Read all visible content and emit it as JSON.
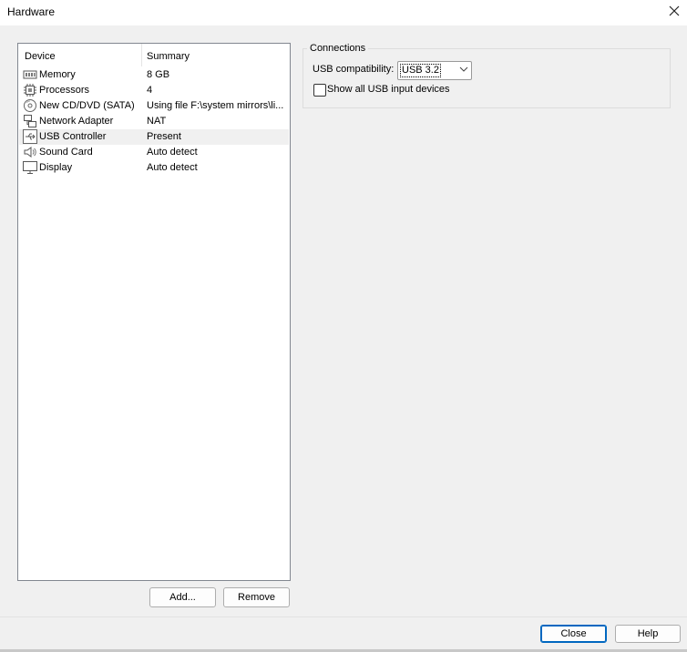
{
  "window": {
    "title": "Hardware"
  },
  "device_list": {
    "headers": {
      "device": "Device",
      "summary": "Summary"
    },
    "rows": [
      {
        "device": "Memory",
        "summary": "8 GB",
        "icon": "memory-icon"
      },
      {
        "device": "Processors",
        "summary": "4",
        "icon": "processor-icon"
      },
      {
        "device": "New CD/DVD (SATA)",
        "summary": "Using file F:\\system mirrors\\li...",
        "icon": "cd-dvd-icon"
      },
      {
        "device": "Network Adapter",
        "summary": "NAT",
        "icon": "network-adapter-icon"
      },
      {
        "device": "USB Controller",
        "summary": "Present",
        "icon": "usb-icon",
        "selected": true
      },
      {
        "device": "Sound Card",
        "summary": "Auto detect",
        "icon": "speaker-icon"
      },
      {
        "device": "Display",
        "summary": "Auto detect",
        "icon": "monitor-icon"
      }
    ]
  },
  "buttons": {
    "add": "Add...",
    "remove": "Remove",
    "close": "Close",
    "help": "Help"
  },
  "connections": {
    "group_label": "Connections",
    "usb_compat_label": "USB compatibility:",
    "usb_compat_value": "USB 3.2",
    "show_all_label": "Show all USB input devices",
    "show_all_checked": false
  }
}
